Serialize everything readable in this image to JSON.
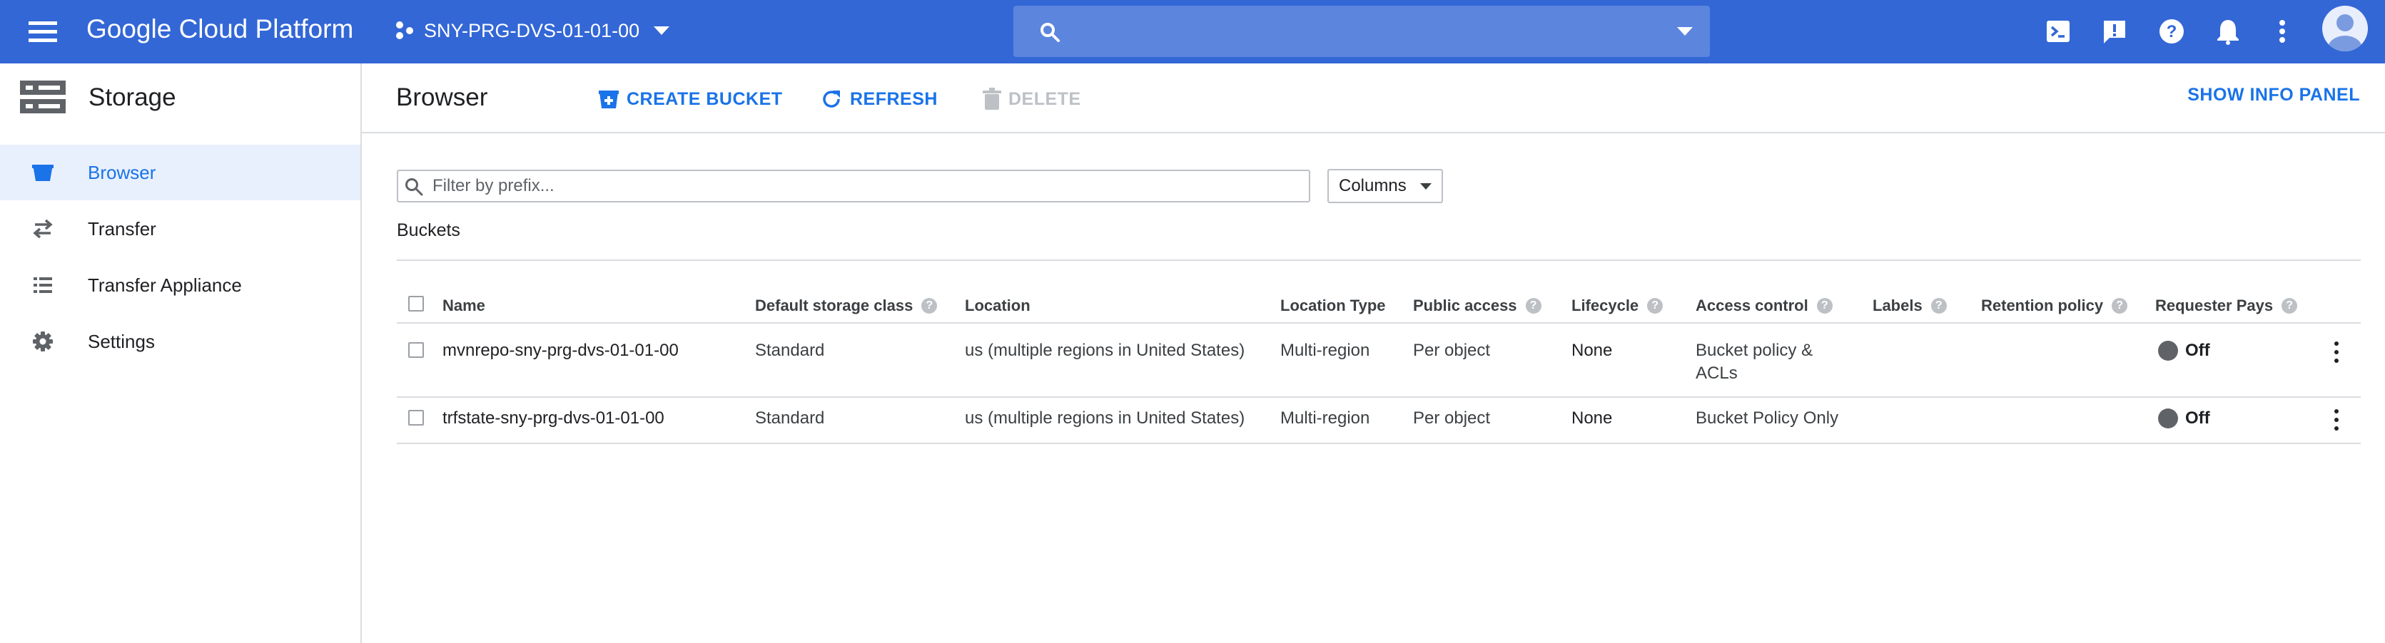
{
  "app": {
    "title": "Google Cloud Platform"
  },
  "project": {
    "name": "SNY-PRG-DVS-01-01-00"
  },
  "topbar_icons": [
    "cloud-shell-icon",
    "feedback-icon",
    "help-icon",
    "notifications-icon",
    "more-vert-icon",
    "account-avatar"
  ],
  "sidebar": {
    "product": "Storage",
    "items": [
      {
        "label": "Browser",
        "icon": "bucket-icon",
        "active": true
      },
      {
        "label": "Transfer",
        "icon": "transfer-arrows-icon",
        "active": false
      },
      {
        "label": "Transfer Appliance",
        "icon": "appliance-list-icon",
        "active": false
      },
      {
        "label": "Settings",
        "icon": "gear-icon",
        "active": false
      }
    ]
  },
  "header": {
    "title": "Browser",
    "create_bucket": "CREATE BUCKET",
    "refresh": "REFRESH",
    "delete": "DELETE",
    "show_info_panel": "SHOW INFO PANEL"
  },
  "filter": {
    "placeholder": "Filter by prefix...",
    "value": ""
  },
  "columns_button": "Columns",
  "section": {
    "title": "Buckets"
  },
  "table": {
    "columns": [
      "Name",
      "Default storage class",
      "Location",
      "Location Type",
      "Public access",
      "Lifecycle",
      "Access control",
      "Labels",
      "Retention policy",
      "Requester Pays"
    ],
    "rows": [
      {
        "name": "mvnrepo-sny-prg-dvs-01-01-00",
        "storage_class": "Standard",
        "location": "us (multiple regions in United States)",
        "location_type": "Multi-region",
        "public_access": "Per object",
        "lifecycle": "None",
        "access_control": "Bucket policy & ACLs",
        "labels": "",
        "retention_policy": "",
        "requester_pays": "Off"
      },
      {
        "name": "trfstate-sny-prg-dvs-01-01-00",
        "storage_class": "Standard",
        "location": "us (multiple regions in United States)",
        "location_type": "Multi-region",
        "public_access": "Per object",
        "lifecycle": "None",
        "access_control": "Bucket Policy Only",
        "labels": "",
        "retention_policy": "",
        "requester_pays": "Off"
      }
    ]
  },
  "colors": {
    "topbar": "#3367d6",
    "search": "#5c85de",
    "accent": "#1a73e8",
    "active_nav_bg": "#e8f0fe",
    "disabled": "#bdc1c6"
  }
}
